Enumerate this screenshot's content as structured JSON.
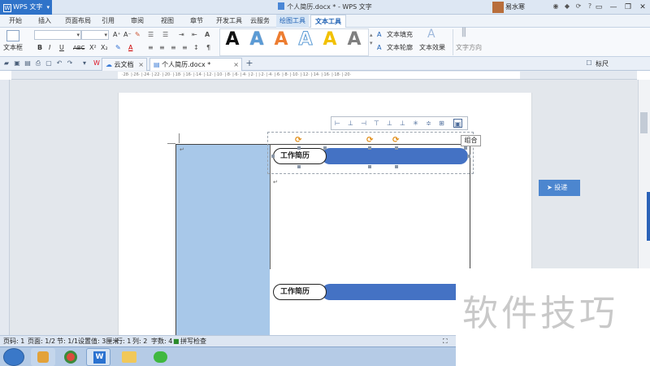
{
  "app": {
    "badge": "WPS 文字",
    "window_title": "个人简历.docx * - WPS 文字",
    "user_name": "易水寒"
  },
  "window_controls": [
    "▭",
    "—",
    "❐",
    "✕"
  ],
  "menu": [
    "开始",
    "插入",
    "页面布局",
    "引用",
    "审阅",
    "视图",
    "章节",
    "开发工具",
    "云服务",
    "绘图工具",
    "文本工具"
  ],
  "ribbon": {
    "text_box": "文本框",
    "font_size_grow": "A⁺",
    "font_size_shrink": "A⁻",
    "bold": "B",
    "italic": "I",
    "underline": "U",
    "strike": "ABC",
    "superscript": "X²",
    "subscript": "X₂",
    "text_fill": "文本填充",
    "text_outline": "文本轮廓",
    "text_effect": "文本效果",
    "text_direction": "文字方向",
    "style_letters": [
      "A",
      "A",
      "A",
      "A",
      "A",
      "A"
    ],
    "style_colors": [
      "#111111",
      "#5b9bd5",
      "#ed7d31",
      "#ffffff",
      "#f2c100",
      "#7f7f7f"
    ]
  },
  "tabs": {
    "cloud_doc": "云文档",
    "doc_name": "个人简历.docx *",
    "add": "+",
    "ruler_label": "标尺"
  },
  "ruler_numbers": "·28· |·26· |·24· |·22· |·20· |·18· |·16· |·14· |·12· |·10· |·8· |·6· |·4· |·2· | |·2· |·4· |·6· |·8· |·10· |·12· |·14· |·16· |·18· |·20·",
  "document": {
    "heading_1": "工作简历",
    "heading_2": "工作简历",
    "paragraph_mark": "↵"
  },
  "floating": {
    "group_tooltip": "组合"
  },
  "side_button": "投递",
  "status": {
    "page_num": "页码: 1",
    "pages": "页面: 1/2",
    "section": "节: 1/1",
    "setting": "设置值: 3厘米",
    "row": "行: 1",
    "col": "列: 2",
    "word_count": "字数: 4",
    "spell_check": "拼写检查"
  },
  "watermark": "软件技巧"
}
